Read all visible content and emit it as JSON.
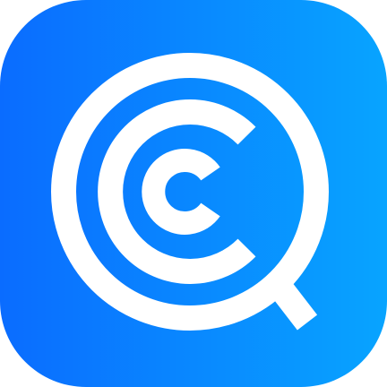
{
  "icon": {
    "name": "concentric-c-search-icon",
    "colors": {
      "gradient_start": "#0A6CFF",
      "gradient_end": "#08A4FF",
      "glyph": "#FFFFFF"
    }
  }
}
